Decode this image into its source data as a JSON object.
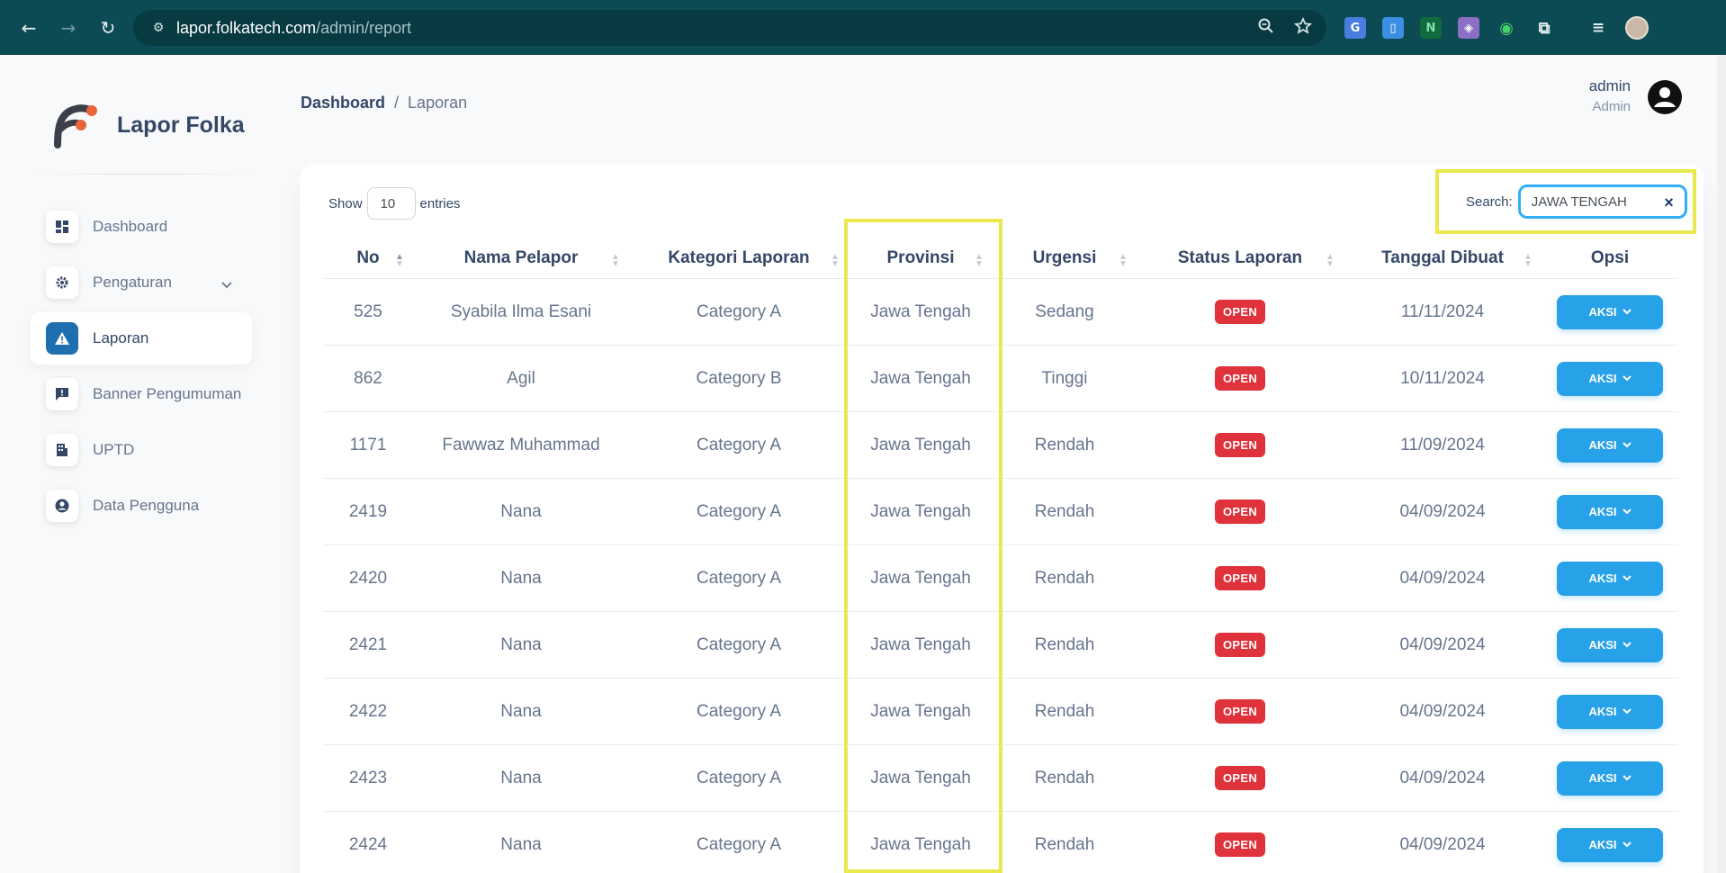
{
  "browser": {
    "url_host": "lapor.folkatech.com",
    "url_path": "/admin/report"
  },
  "sidebar": {
    "brand": "Lapor Folka",
    "items": [
      {
        "label": "Dashboard",
        "icon": "dashboard-icon"
      },
      {
        "label": "Pengaturan",
        "icon": "gear-icon"
      },
      {
        "label": "Laporan",
        "icon": "warning-icon"
      },
      {
        "label": "Banner Pengumuman",
        "icon": "announcement-icon"
      },
      {
        "label": "UPTD",
        "icon": "building-icon"
      },
      {
        "label": "Data Pengguna",
        "icon": "user-circle-icon"
      }
    ]
  },
  "breadcrumb": {
    "root": "Dashboard",
    "separator": "/",
    "current": "Laporan"
  },
  "user": {
    "name": "admin",
    "role": "Admin"
  },
  "table_controls": {
    "show_label": "Show",
    "entries_value": "10",
    "entries_label": "entries",
    "search_label": "Search:",
    "search_value": "JAWA TENGAH",
    "clear_glyph": "×"
  },
  "table": {
    "headers": [
      "No",
      "Nama Pelapor",
      "Kategori Laporan",
      "Provinsi",
      "Urgensi",
      "Status Laporan",
      "Tanggal Dibuat",
      "Opsi"
    ],
    "action_label": "AKSI",
    "rows": [
      {
        "no": "525",
        "nama": "Syabila Ilma Esani",
        "kategori": "Category A",
        "provinsi": "Jawa Tengah",
        "urgensi": "Sedang",
        "status": "OPEN",
        "tanggal": "11/11/2024"
      },
      {
        "no": "862",
        "nama": "Agil",
        "kategori": "Category B",
        "provinsi": "Jawa Tengah",
        "urgensi": "Tinggi",
        "status": "OPEN",
        "tanggal": "10/11/2024"
      },
      {
        "no": "1171",
        "nama": "Fawwaz Muhammad",
        "kategori": "Category A",
        "provinsi": "Jawa Tengah",
        "urgensi": "Rendah",
        "status": "OPEN",
        "tanggal": "11/09/2024"
      },
      {
        "no": "2419",
        "nama": "Nana",
        "kategori": "Category A",
        "provinsi": "Jawa Tengah",
        "urgensi": "Rendah",
        "status": "OPEN",
        "tanggal": "04/09/2024"
      },
      {
        "no": "2420",
        "nama": "Nana",
        "kategori": "Category A",
        "provinsi": "Jawa Tengah",
        "urgensi": "Rendah",
        "status": "OPEN",
        "tanggal": "04/09/2024"
      },
      {
        "no": "2421",
        "nama": "Nana",
        "kategori": "Category A",
        "provinsi": "Jawa Tengah",
        "urgensi": "Rendah",
        "status": "OPEN",
        "tanggal": "04/09/2024"
      },
      {
        "no": "2422",
        "nama": "Nana",
        "kategori": "Category A",
        "provinsi": "Jawa Tengah",
        "urgensi": "Rendah",
        "status": "OPEN",
        "tanggal": "04/09/2024"
      },
      {
        "no": "2423",
        "nama": "Nana",
        "kategori": "Category A",
        "provinsi": "Jawa Tengah",
        "urgensi": "Rendah",
        "status": "OPEN",
        "tanggal": "04/09/2024"
      },
      {
        "no": "2424",
        "nama": "Nana",
        "kategori": "Category A",
        "provinsi": "Jawa Tengah",
        "urgensi": "Rendah",
        "status": "OPEN",
        "tanggal": "04/09/2024"
      }
    ]
  },
  "colors": {
    "chrome_bg": "#0c4a54",
    "accent": "#27a1e8",
    "active_nav": "#1e6fb0",
    "status_open": "#e0323b",
    "highlight": "#e9e84d"
  }
}
